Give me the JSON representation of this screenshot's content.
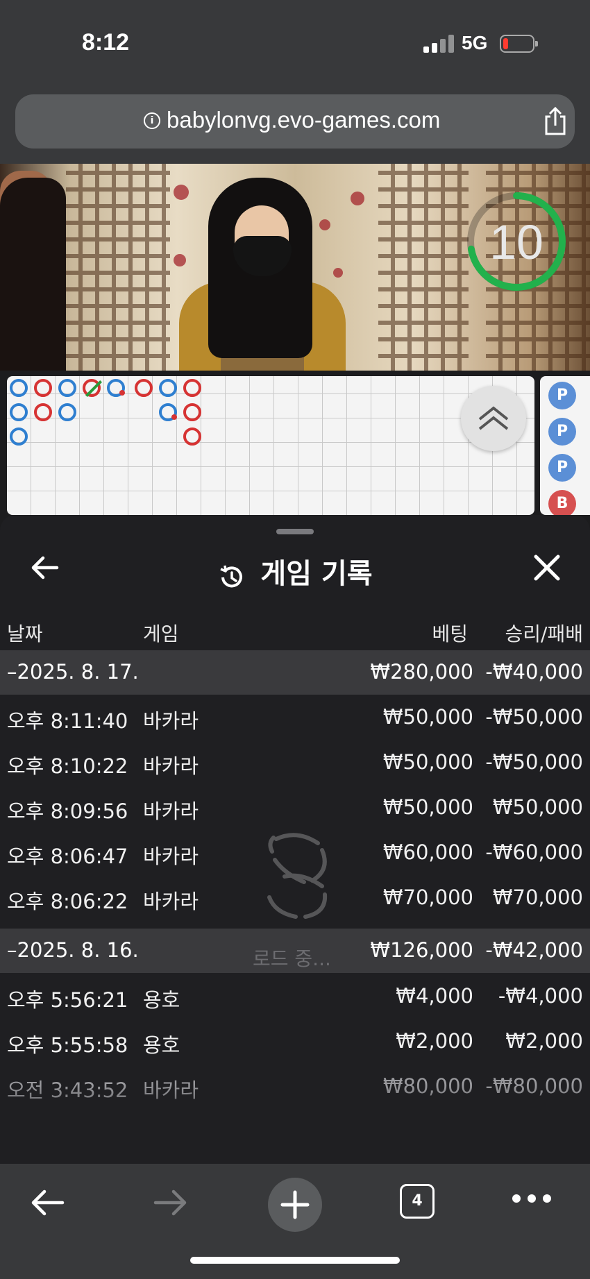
{
  "status_bar": {
    "time": "8:12",
    "network": "5G"
  },
  "browser": {
    "url": "babylonvg.evo-games.com",
    "tab_count": "4"
  },
  "game": {
    "timer": "10",
    "side_road_letters": [
      "P",
      "P",
      "P",
      "B"
    ]
  },
  "history_panel": {
    "title": "게임 기록",
    "columns": {
      "date": "날짜",
      "game": "게임",
      "bet": "베팅",
      "win_loss": "승리/패배"
    },
    "groups": [
      {
        "date": "–2025. 8. 17.",
        "bet": "₩280,000",
        "win_loss": "-₩40,000",
        "rows": [
          {
            "time": "오후 8:11:40",
            "game": "바카라",
            "bet": "₩50,000",
            "win_loss": "-₩50,000"
          },
          {
            "time": "오후 8:10:22",
            "game": "바카라",
            "bet": "₩50,000",
            "win_loss": "-₩50,000"
          },
          {
            "time": "오후 8:09:56",
            "game": "바카라",
            "bet": "₩50,000",
            "win_loss": "₩50,000"
          },
          {
            "time": "오후 8:06:47",
            "game": "바카라",
            "bet": "₩60,000",
            "win_loss": "-₩60,000"
          },
          {
            "time": "오후 8:06:22",
            "game": "바카라",
            "bet": "₩70,000",
            "win_loss": "₩70,000"
          }
        ]
      },
      {
        "date": "–2025. 8. 16.",
        "bet": "₩126,000",
        "win_loss": "-₩42,000",
        "rows": [
          {
            "time": "오후 5:56:21",
            "game": "용호",
            "bet": "₩4,000",
            "win_loss": "-₩4,000"
          },
          {
            "time": "오후 5:55:58",
            "game": "용호",
            "bet": "₩2,000",
            "win_loss": "₩2,000"
          },
          {
            "time": "오전 3:43:52",
            "game": "바카라",
            "bet": "₩80,000",
            "win_loss": "-₩80,000"
          }
        ]
      }
    ],
    "loading_text": "로드 중..."
  },
  "colors": {
    "banker": "#d63333",
    "player": "#2f7fd0",
    "tie": "#2a9b3a",
    "timer_ring": "#22b14c"
  }
}
